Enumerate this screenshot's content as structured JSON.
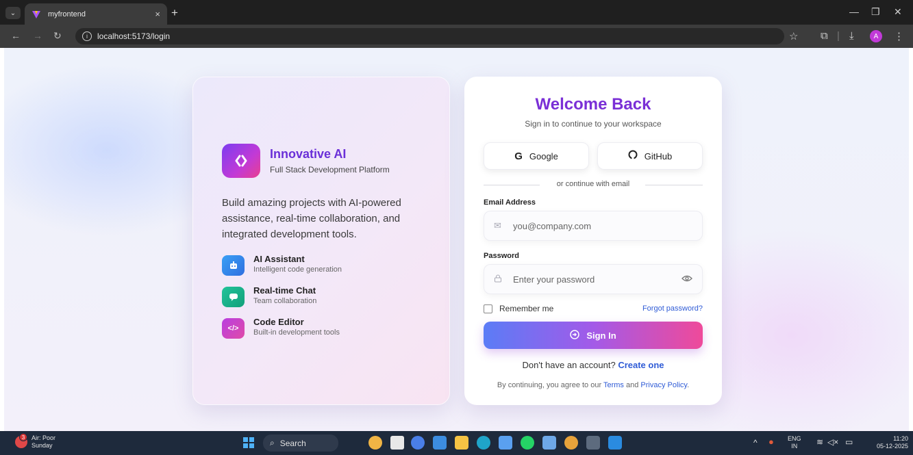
{
  "browser": {
    "tab_title": "myfrontend",
    "tab_close": "×",
    "new_tab": "+",
    "url": "localhost:5173/login",
    "profile_initial": "A"
  },
  "brand": {
    "name": "Innovative AI",
    "tagline": "Full Stack Development Platform",
    "description": "Build amazing projects with AI-powered assistance, real-time collaboration, and integrated development tools.",
    "features": [
      {
        "title": "AI Assistant",
        "desc": "Intelligent code generation",
        "icon": "robot-icon",
        "color": "#2f8ff0"
      },
      {
        "title": "Real-time Chat",
        "desc": "Team collaboration",
        "icon": "chat-icon",
        "color": "#1fb58a"
      },
      {
        "title": "Code Editor",
        "desc": "Built-in development tools",
        "icon": "code-icon",
        "color": "#c73fd8"
      }
    ]
  },
  "login": {
    "title": "Welcome Back",
    "subtitle": "Sign in to continue to your workspace",
    "google_label": "Google",
    "github_label": "GitHub",
    "divider_text": "or continue with email",
    "email_label": "Email Address",
    "email_placeholder": "you@company.com",
    "password_label": "Password",
    "password_placeholder": "Enter your password",
    "remember_label": "Remember me",
    "forgot_label": "Forgot password?",
    "signin_label": "Sign In",
    "signup_prompt": "Don't have an account?",
    "signup_link": "Create one",
    "terms_prefix": "By continuing, you agree to our",
    "terms_link": "Terms",
    "terms_and": "and",
    "privacy_link": "Privacy Policy",
    "terms_suffix": ".",
    "accent_color": "#7a2fd6",
    "link_color": "#2f5bd6"
  },
  "taskbar": {
    "weather_title": "Air: Poor",
    "weather_sub": "Sunday",
    "weather_badge": "3",
    "search_label": "Search",
    "lang_top": "ENG",
    "lang_bottom": "IN",
    "time": "11:20",
    "date": "05-12-2025"
  }
}
